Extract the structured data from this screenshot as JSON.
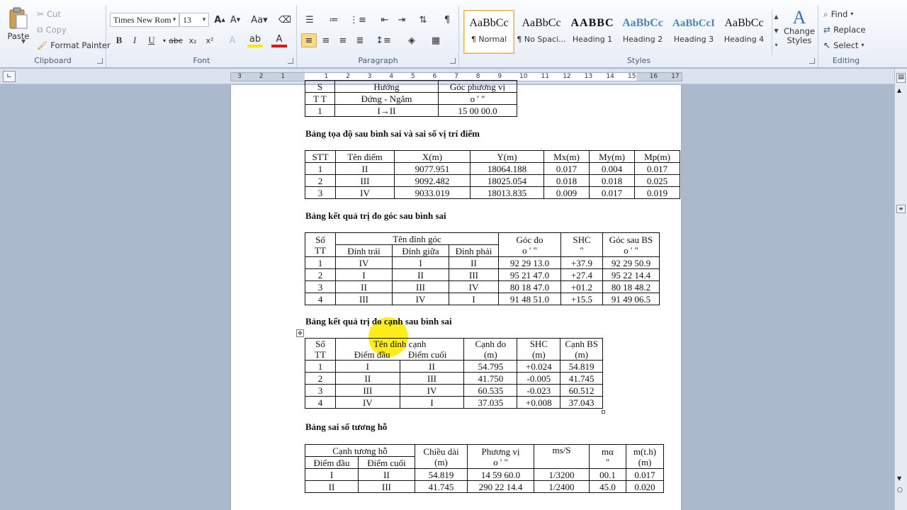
{
  "ribbon": {
    "clipboard": {
      "label": "Clipboard",
      "paste": "Paste",
      "cut": "Cut",
      "copy": "Copy",
      "format_painter": "Format Painter"
    },
    "font": {
      "label": "Font",
      "font_name": "Times New Rom",
      "font_size": "13"
    },
    "paragraph": {
      "label": "Paragraph"
    },
    "styles": {
      "label": "Styles",
      "items": [
        {
          "sample": "AaBbCc",
          "name": "¶ Normal"
        },
        {
          "sample": "AaBbCc",
          "name": "¶ No Spaci..."
        },
        {
          "sample": "AABBC",
          "name": "Heading 1"
        },
        {
          "sample": "AaBbCc",
          "name": "Heading 2"
        },
        {
          "sample": "AaBbCcI",
          "name": "Heading 3"
        },
        {
          "sample": "AaBbCc",
          "name": "Heading 4"
        }
      ],
      "change_styles": "Change Styles"
    },
    "editing": {
      "label": "Editing",
      "find": "Find",
      "replace": "Replace",
      "select": "Select"
    }
  },
  "ruler": {
    "numbers": [
      "3",
      "2",
      "1",
      "1",
      "2",
      "3",
      "4",
      "5",
      "6",
      "7",
      "8",
      "9",
      "10",
      "11",
      "12",
      "13",
      "14",
      "15",
      "16",
      "17"
    ]
  },
  "document": {
    "table0": {
      "rows": [
        [
          "S",
          "Hướng",
          "Góc phương vị"
        ],
        [
          "T T",
          "Đứng - Ngắm",
          "o     '     \""
        ],
        [
          "1",
          "I→II",
          "15 00 00.0"
        ]
      ]
    },
    "caption1": "Bảng tọa độ sau bình sai và sai số vị trí điểm",
    "table1": {
      "header": [
        "STT",
        "Tên điểm",
        "X(m)",
        "Y(m)",
        "Mx(m)",
        "My(m)",
        "Mp(m)"
      ],
      "rows": [
        [
          "1",
          "II",
          "9077.951",
          "18064.188",
          "0.017",
          "0.004",
          "0.017"
        ],
        [
          "2",
          "III",
          "9092.482",
          "18025.054",
          "0.018",
          "0.018",
          "0.025"
        ],
        [
          "3",
          "IV",
          "9033.019",
          "18013.835",
          "0.009",
          "0.017",
          "0.019"
        ]
      ]
    },
    "caption2": "Bảng kết quả trị đo góc sau bình sai",
    "table2": {
      "h_so": "Số",
      "h_tt": "TT",
      "h_ten": "Tên đỉnh góc",
      "h_trai": "Đỉnh trái",
      "h_giua": "Đỉnh giữa",
      "h_phai": "Đỉnh phải",
      "h_goc": "Góc đo",
      "h_goc_unit": "o     '     \"",
      "h_shc": "SHC",
      "h_shc_unit": "\"",
      "h_bs": "Góc sau BS",
      "h_bs_unit": "o     '     \"",
      "rows": [
        [
          "1",
          "IV",
          "I",
          "II",
          "92 29 13.0",
          "+37.9",
          "92 29 50.9"
        ],
        [
          "2",
          "I",
          "II",
          "III",
          "95 21 47.0",
          "+27.4",
          "95 22 14.4"
        ],
        [
          "3",
          "II",
          "III",
          "IV",
          "80 18 47.0",
          "+01.2",
          "80 18 48.2"
        ],
        [
          "4",
          "III",
          "IV",
          "I",
          "91 48 51.0",
          "+15.5",
          "91 49 06.5"
        ]
      ]
    },
    "caption3": "Bảng kết quả trị đo cạnh sau bình sai",
    "table3": {
      "h_so": "Số",
      "h_tt": "TT",
      "h_ten": "Tên đỉnh cạnh",
      "h_dau": "Điểm đầu",
      "h_cuoi": "Điểm cuối",
      "h_canh": "Cạnh đo",
      "h_canh_unit": "(m)",
      "h_shc": "SHC",
      "h_shc_unit": "(m)",
      "h_bs": "Cạnh BS",
      "h_bs_unit": "(m)",
      "rows": [
        [
          "1",
          "I",
          "II",
          "54.795",
          "+0.024",
          "54.819"
        ],
        [
          "2",
          "II",
          "III",
          "41.750",
          "-0.005",
          "41.745"
        ],
        [
          "3",
          "III",
          "IV",
          "60.535",
          "-0.023",
          "60.512"
        ],
        [
          "4",
          "IV",
          "I",
          "37.035",
          "+0.008",
          "37.043"
        ]
      ]
    },
    "caption4": "Bảng sai số tương hỗ",
    "table4": {
      "h_canh": "Cạnh tương hỗ",
      "h_dau": "Điểm đầu",
      "h_cuoi": "Điểm cuối",
      "h_dai": "Chiều dài",
      "h_dai_unit": "(m)",
      "h_pv": "Phương vị",
      "h_pv_unit": "o     '     \"",
      "h_ms": "ms/S",
      "h_ma": "mα",
      "h_ma_unit": "\"",
      "h_mth": "m(t.h)",
      "h_mth_unit": "(m)",
      "rows": [
        [
          "I",
          "II",
          "54.819",
          "14 59 60.0",
          "1/3200",
          "00.1",
          "0.017"
        ],
        [
          "II",
          "III",
          "41.745",
          "290 22 14.4",
          "1/2400",
          "45.0",
          "0.020"
        ]
      ]
    }
  },
  "colors": {
    "ribbon_bg": "#e7edf6",
    "workspace": "#abb9cc",
    "style_selected": "#e3b453",
    "highlight": "#ffeb00"
  }
}
